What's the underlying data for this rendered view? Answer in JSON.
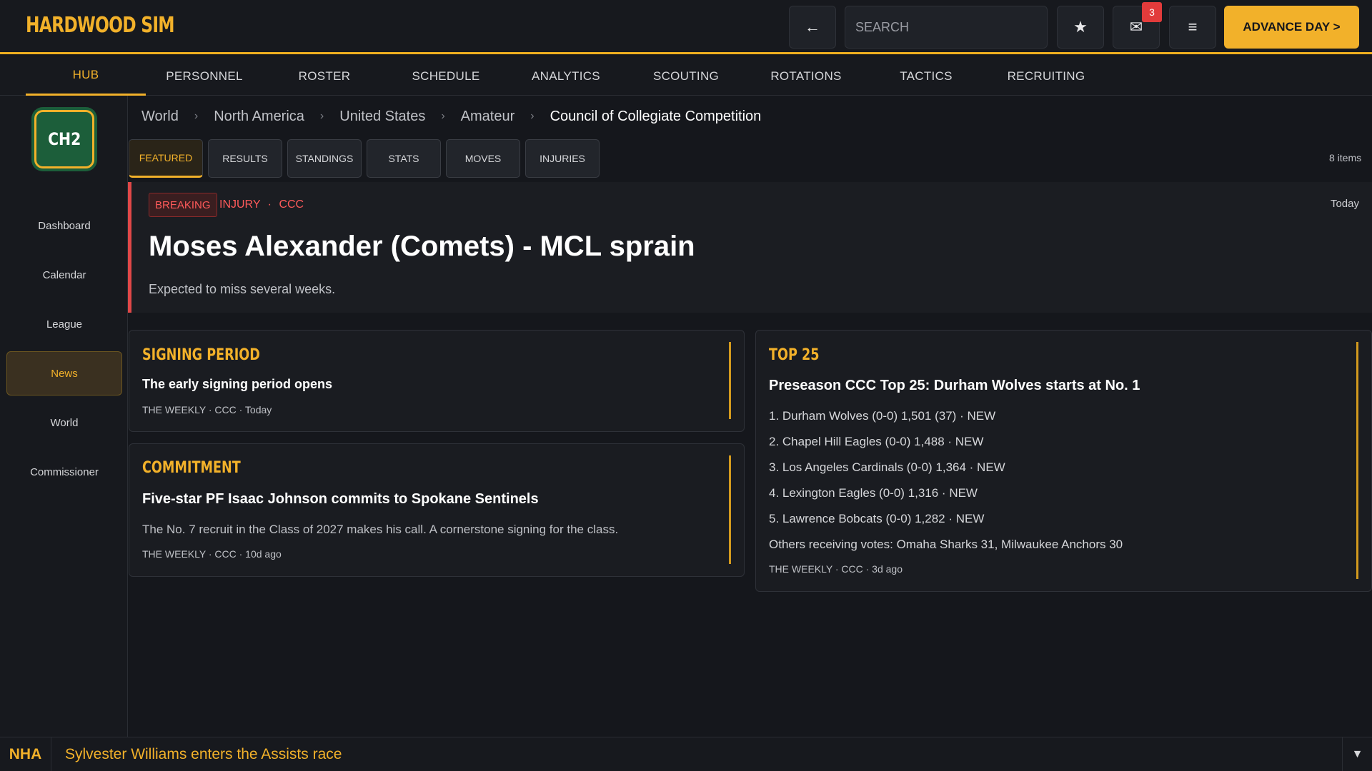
{
  "app": {
    "title": "HARDWOOD SIM"
  },
  "topbar": {
    "back_icon": "←",
    "search_placeholder": "SEARCH",
    "star_icon": "★",
    "mail_icon": "✉",
    "mail_count": "3",
    "menu_icon": "≡",
    "advance_label": "ADVANCE DAY >"
  },
  "nav": {
    "tabs": [
      "HUB",
      "PERSONNEL",
      "ROSTER",
      "SCHEDULE",
      "ANALYTICS",
      "SCOUTING",
      "ROTATIONS",
      "TACTICS",
      "RECRUITING"
    ],
    "active": "HUB"
  },
  "sidebar": {
    "team_abbr": "CH2",
    "items": [
      "Dashboard",
      "Calendar",
      "League",
      "News",
      "World",
      "Commissioner"
    ],
    "active": "News"
  },
  "breadcrumb": {
    "items": [
      "World",
      "North America",
      "United States",
      "Amateur"
    ],
    "current": "Council of Collegiate Competition",
    "separator": "›"
  },
  "subtabs": {
    "items": [
      "FEATURED",
      "RESULTS",
      "STANDINGS",
      "STATS",
      "MOVES",
      "INJURIES"
    ],
    "active": "FEATURED",
    "count_label": "8 items"
  },
  "featured": {
    "badge": "BREAKING",
    "category": "INJURY",
    "league": "CCC",
    "dot": "·",
    "time": "Today",
    "title": "Moses Alexander (Comets) - MCL sprain",
    "subtitle": "Expected to miss several weeks."
  },
  "cards": {
    "signing": {
      "kicker": "SIGNING PERIOD",
      "title": "The early signing period opens",
      "meta": "THE WEEKLY  ·  CCC  ·  Today"
    },
    "commitment": {
      "kicker": "COMMITMENT",
      "title": "Five-star PF Isaac Johnson commits to Spokane Sentinels",
      "body": "The No. 7 recruit in the Class of 2027 makes his call. A cornerstone signing for the class.",
      "meta": "THE WEEKLY  ·  CCC  ·  10d ago"
    },
    "top25": {
      "kicker": "TOP 25",
      "title": "Preseason CCC Top 25: Durham Wolves starts at No. 1",
      "rankings": [
        "1. Durham Wolves (0-0) 1,501 (37) · NEW",
        "2. Chapel Hill Eagles (0-0) 1,488 · NEW",
        "3. Los Angeles Cardinals (0-0) 1,364 · NEW",
        "4. Lexington Eagles (0-0) 1,316 · NEW",
        "5. Lawrence Bobcats (0-0) 1,282 · NEW"
      ],
      "others": "Others receiving votes: Omaha Sharks 31, Milwaukee Anchors 30",
      "meta": "THE WEEKLY  ·  CCC  ·  3d ago"
    }
  },
  "ticker": {
    "league": "NHA",
    "text": "Sylvester Williams enters the Assists race",
    "toggle_icon": "▼"
  },
  "colors": {
    "accent": "#f2b12a",
    "breaking": "#e04848",
    "background": "#15171c"
  }
}
